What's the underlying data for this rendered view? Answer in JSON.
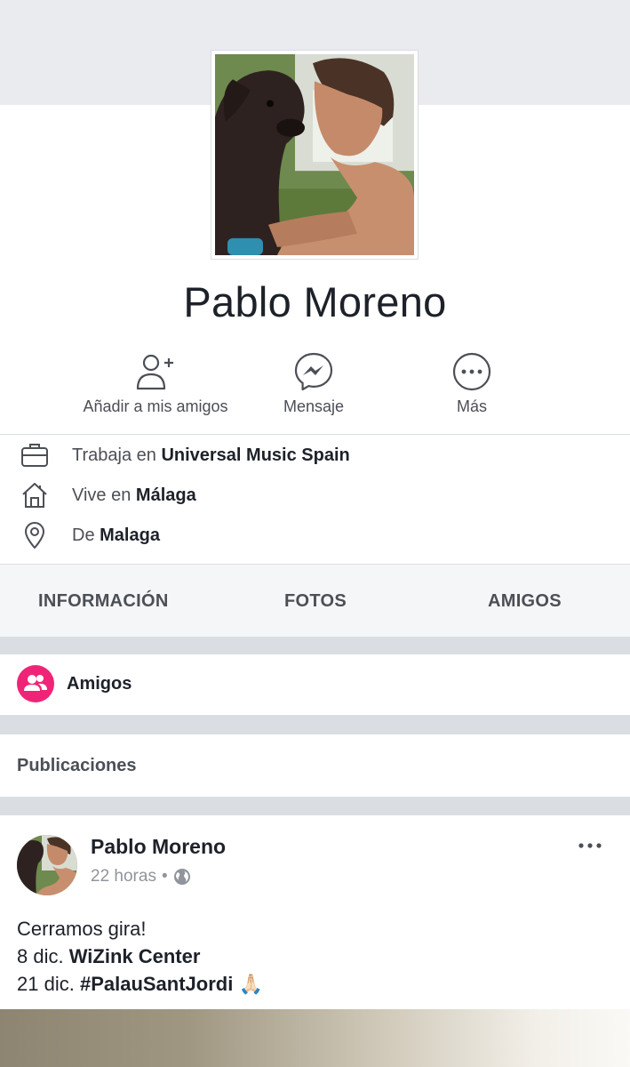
{
  "profile": {
    "name": "Pablo Moreno",
    "photo_icon": "profile-photo-man-kissing-dog"
  },
  "actions": [
    {
      "label": "Añadir a mis amigos",
      "icon": "add-friend-icon"
    },
    {
      "label": "Mensaje",
      "icon": "messenger-icon"
    },
    {
      "label": "Más",
      "icon": "more-circle-icon"
    }
  ],
  "info": {
    "work": {
      "prefix": "Trabaja en",
      "value": "Universal Music Spain",
      "icon": "briefcase-icon"
    },
    "lives": {
      "prefix": "Vive en",
      "value": "Málaga",
      "icon": "home-icon"
    },
    "from": {
      "prefix": "De",
      "value": "Malaga",
      "icon": "location-pin-icon"
    }
  },
  "tabs": [
    "INFORMACIÓN",
    "FOTOS",
    "AMIGOS"
  ],
  "friends_section": {
    "label": "Amigos",
    "icon": "friends-icon",
    "badge_color": "#f02477"
  },
  "publications": {
    "label": "Publicaciones"
  },
  "post": {
    "author": "Pablo Moreno",
    "time": "22 horas",
    "separator": "•",
    "privacy_icon": "globe-icon",
    "more_icon": "more-dots-icon",
    "line1": "Cerramos gira!",
    "line2_prefix": "8 dic.",
    "line2_bold": "WiZink Center",
    "line3_prefix": "21 dic.",
    "line3_bold": "#PalauSantJordi",
    "emoji": "🙏🏻"
  },
  "colors": {
    "accent": "#f02477",
    "text": "#1d2129",
    "secondary": "#4b4f56",
    "muted": "#90949c",
    "background_gray": "#e9ebee"
  }
}
